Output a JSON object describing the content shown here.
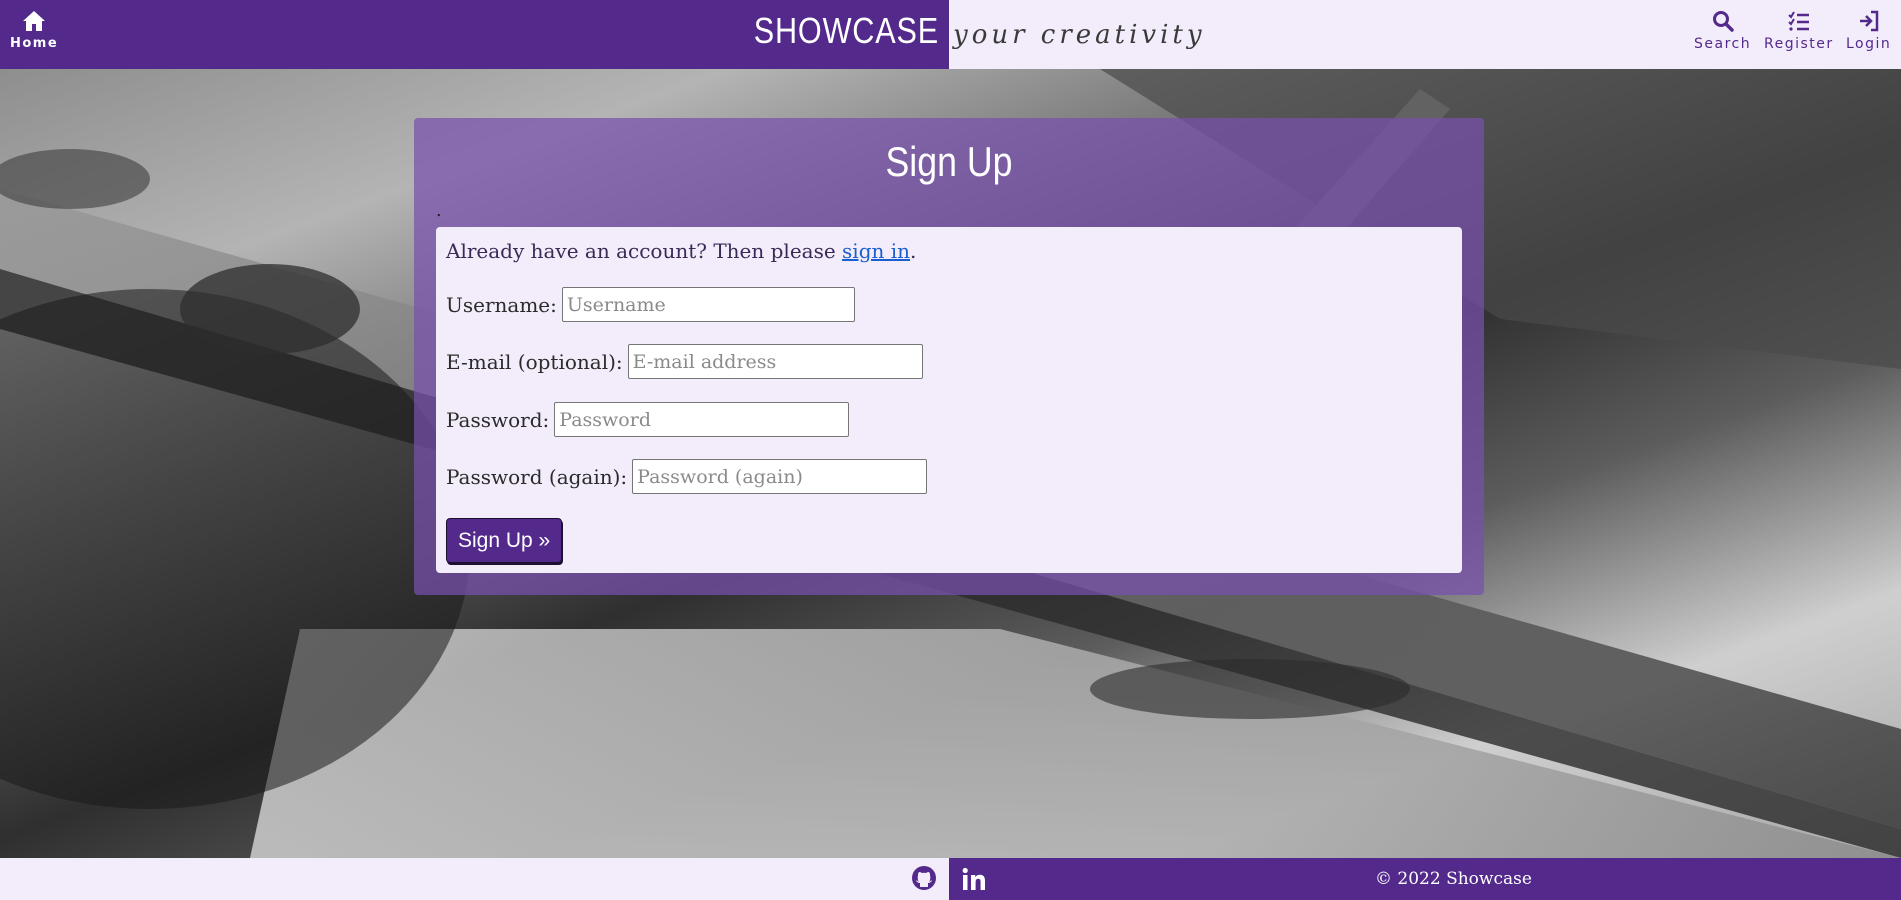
{
  "header": {
    "home_label": "Home",
    "brand": "SHOWCASE",
    "tagline": "your creativity",
    "nav": [
      {
        "label": "Search",
        "icon": "search-icon"
      },
      {
        "label": "Register",
        "icon": "checklist-icon"
      },
      {
        "label": "Login",
        "icon": "login-icon"
      }
    ]
  },
  "signup": {
    "title": "Sign Up",
    "dot": ".",
    "intro_prefix": "Already have an account? Then please ",
    "intro_link": "sign in",
    "intro_suffix": ".",
    "fields": [
      {
        "label": "Username:",
        "placeholder": "Username",
        "value": ""
      },
      {
        "label": "E-mail (optional):",
        "placeholder": "E-mail address",
        "value": ""
      },
      {
        "label": "Password:",
        "placeholder": "Password",
        "value": ""
      },
      {
        "label": "Password (again):",
        "placeholder": "Password (again)",
        "value": ""
      }
    ],
    "submit_label": "Sign Up »"
  },
  "footer": {
    "icons": [
      "github-icon",
      "linkedin-icon"
    ],
    "copyright": "© 2022 Showcase"
  },
  "colors": {
    "brand_purple": "#532a8c",
    "light_lavender": "#f3ecfa",
    "link_blue": "#1a5fd0"
  }
}
